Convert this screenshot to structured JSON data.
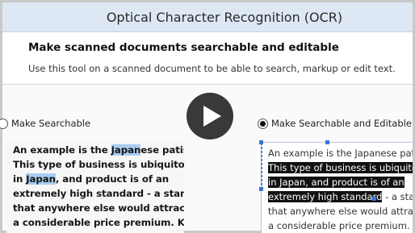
{
  "window": {
    "title": "Optical Character Recognition (OCR)"
  },
  "header": {
    "heading": "Make scanned documents searchable and editable",
    "description": "Use this tool on a scanned document to be able to search, markup or edit text."
  },
  "options": {
    "left_label": "Make Searchable",
    "left_selected": false,
    "right_label": "Make Searchable and Editable",
    "right_selected": true
  },
  "scanned_preview": {
    "lines": [
      {
        "pre": "An example is the ",
        "hl": "Japan",
        "post": "ese patisserie."
      },
      {
        "pre": "This type of business is ubiquitous",
        "hl": "",
        "post": ""
      },
      {
        "pre": "in ",
        "hl": "Japan",
        "post": ", and product is of an"
      },
      {
        "pre": "extremely high standard - a standard",
        "hl": "",
        "post": ""
      },
      {
        "pre": "that anywhere else would attract",
        "hl": "",
        "post": ""
      },
      {
        "pre": "a considerable price premium. Key",
        "hl": "",
        "post": ""
      }
    ]
  },
  "ocr_preview": {
    "lines": [
      {
        "selected": "",
        "rest": "An example is the Japanese patisserie."
      },
      {
        "selected": "This type of business is ubiquitous",
        "rest": ""
      },
      {
        "selected": "in Japan, and product is of an",
        "rest": ""
      },
      {
        "selected": "extremely high standard",
        "rest": " - a standard"
      },
      {
        "selected": "",
        "rest": "that anywhere else would attract"
      },
      {
        "selected": "",
        "rest": "a considerable price premium. Key"
      }
    ]
  },
  "video": {
    "icon": "play-icon"
  },
  "colors": {
    "titlebar": "#dde8f4",
    "highlight": "#a9cdf2",
    "selection": "#111111",
    "handle": "#3b74d9"
  }
}
